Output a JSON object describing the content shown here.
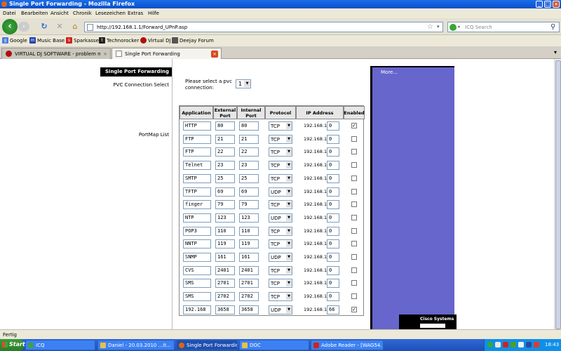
{
  "window": {
    "title": "Single Port Forwarding - Mozilla Firefox"
  },
  "menu": [
    "Datei",
    "Bearbeiten",
    "Ansicht",
    "Chronik",
    "Lesezeichen",
    "Extras",
    "Hilfe"
  ],
  "nav": {
    "url": "http://192.168.1.1/Forward_UPnP.asp",
    "search_placeholder": "ICQ Search"
  },
  "bookmarks": [
    "Google",
    "Music Base",
    "Sparkasse",
    "Technorocker",
    "Virtual DJ",
    "Deejay Forum"
  ],
  "tabs": [
    "VIRTUAL DJ SOFTWARE - problem mit ...",
    "Single Port Forwarding"
  ],
  "page": {
    "section_header": "Single Port Forwarding",
    "pvc_label": "PVC Connection Select",
    "pvc_prompt": "Please select a pvc connection:",
    "pvc_value": "1",
    "portmap_label": "PortMap List",
    "more_link": "More...",
    "cisco": "Cisco Systems",
    "headers": [
      "Application",
      "External Port",
      "Internal Port",
      "Protocol",
      "IP Address",
      "Enabled"
    ],
    "ip_prefix": "192.168.1.",
    "rows": [
      {
        "app": "HTTP",
        "ext": "80",
        "int": "80",
        "proto": "TCP",
        "ip": "0",
        "enabled": true
      },
      {
        "app": "FTP",
        "ext": "21",
        "int": "21",
        "proto": "TCP",
        "ip": "0",
        "enabled": false
      },
      {
        "app": "FTP",
        "ext": "22",
        "int": "22",
        "proto": "TCP",
        "ip": "0",
        "enabled": false
      },
      {
        "app": "Telnet",
        "ext": "23",
        "int": "23",
        "proto": "TCP",
        "ip": "0",
        "enabled": false
      },
      {
        "app": "SMTP",
        "ext": "25",
        "int": "25",
        "proto": "TCP",
        "ip": "0",
        "enabled": false
      },
      {
        "app": "TFTP",
        "ext": "69",
        "int": "69",
        "proto": "UDP",
        "ip": "0",
        "enabled": false
      },
      {
        "app": "finger",
        "ext": "79",
        "int": "79",
        "proto": "TCP",
        "ip": "0",
        "enabled": false
      },
      {
        "app": "NTP",
        "ext": "123",
        "int": "123",
        "proto": "UDP",
        "ip": "0",
        "enabled": false
      },
      {
        "app": "POP3",
        "ext": "110",
        "int": "110",
        "proto": "TCP",
        "ip": "0",
        "enabled": false
      },
      {
        "app": "NNTP",
        "ext": "119",
        "int": "119",
        "proto": "TCP",
        "ip": "0",
        "enabled": false
      },
      {
        "app": "SNMP",
        "ext": "161",
        "int": "161",
        "proto": "UDP",
        "ip": "0",
        "enabled": false
      },
      {
        "app": "CVS",
        "ext": "2401",
        "int": "2401",
        "proto": "TCP",
        "ip": "0",
        "enabled": false
      },
      {
        "app": "SMS",
        "ext": "2701",
        "int": "2701",
        "proto": "TCP",
        "ip": "0",
        "enabled": false
      },
      {
        "app": "SMS",
        "ext": "2702",
        "int": "2702",
        "proto": "TCP",
        "ip": "0",
        "enabled": false
      },
      {
        "app": "192.168",
        "ext": "3658",
        "int": "3658",
        "proto": "UDP",
        "ip": "66",
        "enabled": true
      }
    ]
  },
  "status": "Fertig",
  "taskbar": {
    "start": "Start",
    "items": [
      "ICQ",
      "Daniel - 20.03.2010 ...it...",
      "Single Port Forwardin...",
      "DOC",
      "Adobe Reader - [WAG54..."
    ],
    "clock": "18:43"
  },
  "colors": {
    "accent_panel": "#6666cc",
    "title_blue": "#0a4fcd"
  }
}
